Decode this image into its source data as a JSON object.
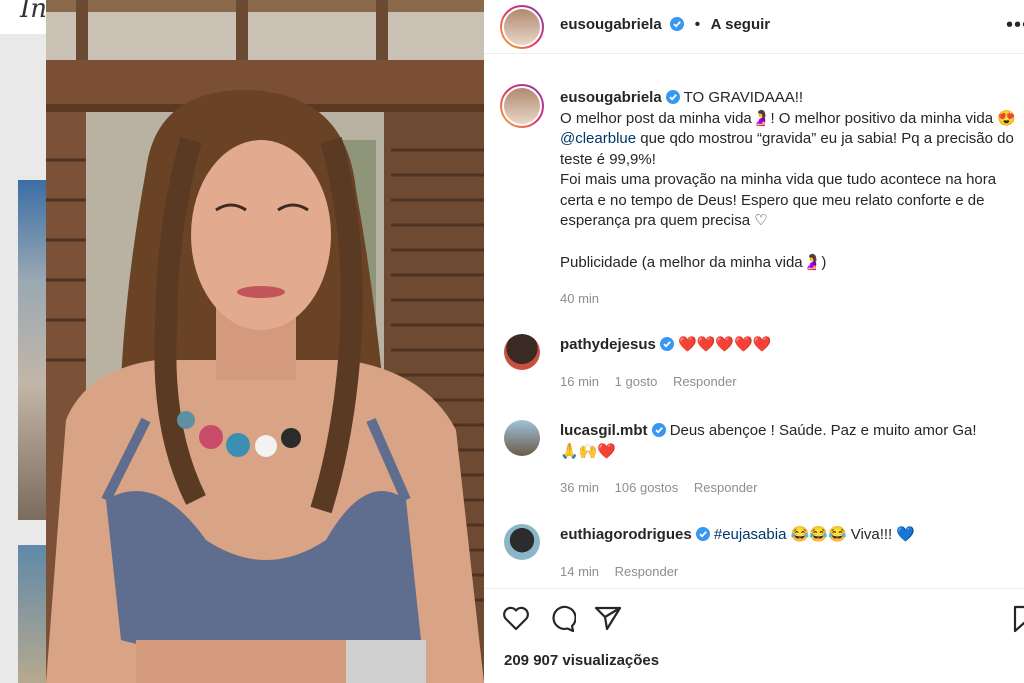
{
  "background": {
    "logo_fragment": "In"
  },
  "post": {
    "username": "eusougabriela",
    "follow_label": "A seguir",
    "more_label": "•••",
    "caption": {
      "headline": "TO GRAVIDAAA!!",
      "line1_a": "O melhor post da minha vida",
      "line1_emoji": "🤰",
      "line1_b": "! O melhor positivo da minha vida",
      "line2_emoji": "😍",
      "mention": "@clearblue",
      "line2_b": " que qdo mostrou “gravida” eu ja sabia! Pq a precisão do teste é 99,9%!",
      "paragraph2": "Foi mais uma provação na minha vida que tudo acontece na hora certa e no tempo de Deus! Espero que meu relato conforte e de esperança pra quem precisa",
      "heart": "♡",
      "publicidade_a": "Publicidade (a melhor da minha vida",
      "publicidade_emoji": "🤰",
      "publicidade_b": ")",
      "time": "40 min"
    },
    "comments": [
      {
        "username": "pathydejesus",
        "text": "❤️❤️❤️❤️❤️",
        "time": "16 min",
        "likes": "1 gosto",
        "reply": "Responder"
      },
      {
        "username": "lucasgil.mbt",
        "text": "Deus abençoe ! Saúde. Paz e muito amor Ga!",
        "text2": "🙏🙌❤️",
        "time": "36 min",
        "likes": "106 gostos",
        "reply": "Responder"
      },
      {
        "username": "euthiagorodrigues",
        "hashtag": "#eujasabia",
        "text": " 😂😂😂 Viva!!! 💙",
        "time": "14 min",
        "reply": "Responder"
      }
    ],
    "views": "209 907 visualizações"
  },
  "colors": {
    "verified": "#3897f0",
    "link": "#00376b",
    "muted": "#8e8e8e"
  }
}
